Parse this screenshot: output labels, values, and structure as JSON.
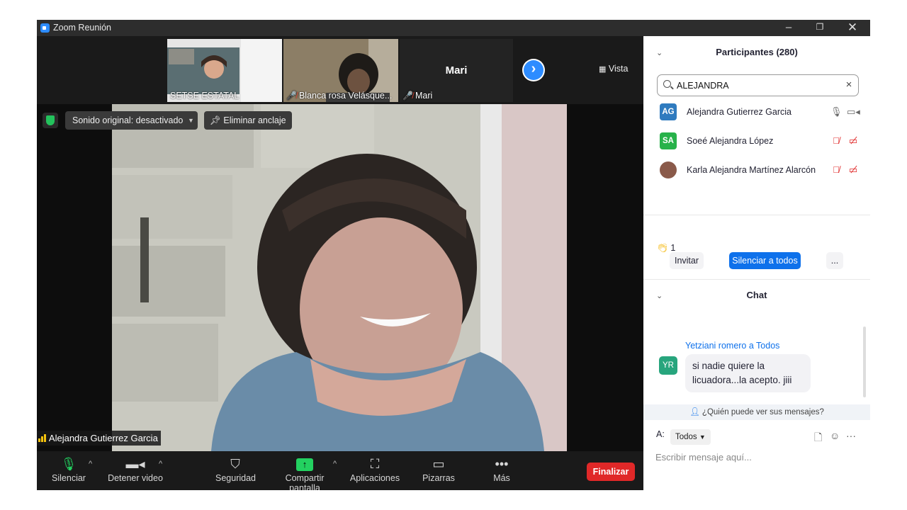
{
  "window": {
    "title": "Zoom Reunión"
  },
  "gallery": {
    "tiles": [
      {
        "name": "SETSE ESTATAL",
        "muted": false
      },
      {
        "name": "Blanca rosa Velásque...",
        "muted": true
      },
      {
        "name": "Mari",
        "muted": true,
        "display_name": "Mari"
      }
    ],
    "view_label": "Vista"
  },
  "video_controls": {
    "original_sound": "Sonido original: desactivado",
    "unpin": "Eliminar anclaje"
  },
  "active_speaker": {
    "name": "Alejandra Gutierrez Garcia"
  },
  "toolbar": {
    "mute": "Silenciar",
    "stop_video": "Detener video",
    "security": "Seguridad",
    "share_screen": "Compartir pantalla",
    "apps": "Aplicaciones",
    "whiteboards": "Pizarras",
    "more": "Más",
    "end": "Finalizar"
  },
  "participants": {
    "title": "Participantes (280)",
    "search_value": "ALEJANDRA",
    "list": [
      {
        "initials": "AG",
        "name": "Alejandra Gutierrez Garcia",
        "color": "#2f7bbf",
        "mic": "on",
        "cam": "on"
      },
      {
        "initials": "SA",
        "name": "Soeé Alejandra López",
        "color": "#27b24a",
        "mic": "off",
        "cam": "off"
      },
      {
        "initials": "",
        "name": "Karla Alejandra Martínez Alarcón",
        "color": "#8a5a4a",
        "mic": "off",
        "cam": "off"
      }
    ],
    "reaction_count": "1",
    "invite": "Invitar",
    "mute_all": "Silenciar a todos",
    "more": "..."
  },
  "chat": {
    "title": "Chat",
    "messages": [
      {
        "initials": "YR",
        "from": "Yetziani romero a Todos",
        "text": "si nadie quiere la licuadora...la acepto. jiii"
      }
    ],
    "who_can_see": "¿Quién puede ver sus mensajes?",
    "to_label": "A:",
    "to_value": "Todos",
    "placeholder": "Escribir mensaje aquí..."
  },
  "colors": {
    "accent": "#0e71eb",
    "end": "#e02828",
    "share": "#23d160",
    "muted": "#e02828"
  }
}
